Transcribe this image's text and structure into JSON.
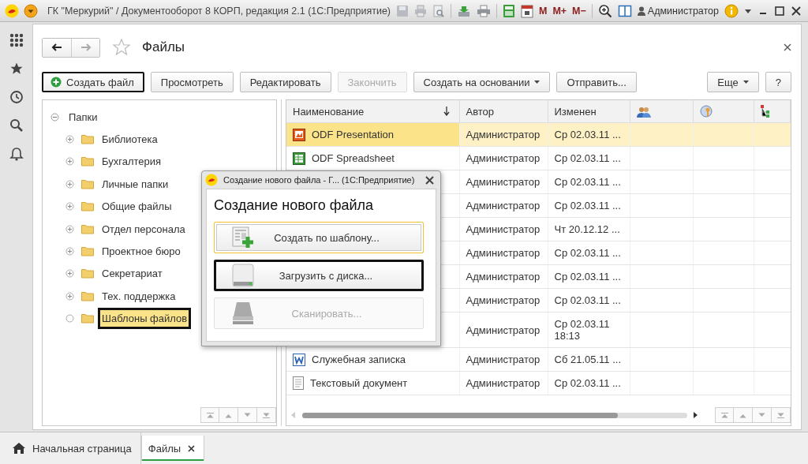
{
  "window": {
    "title": "ГК \"Меркурий\" / Документооборот 8 КОРП, редакция 2.1  (1С:Предприятие)",
    "memory_buttons": [
      "M",
      "M+",
      "M−"
    ],
    "user": "Администратор"
  },
  "page": {
    "title": "Файлы"
  },
  "toolbar": [
    {
      "label": "Создать файл",
      "kind": "create",
      "focused": true,
      "disabled": false
    },
    {
      "label": "Просмотреть",
      "kind": "plain",
      "focused": false,
      "disabled": false
    },
    {
      "label": "Редактировать",
      "kind": "plain",
      "focused": false,
      "disabled": false
    },
    {
      "label": "Закончить",
      "kind": "plain",
      "focused": false,
      "disabled": true
    },
    {
      "label": "Создать на основании",
      "kind": "menu",
      "focused": false,
      "disabled": false
    },
    {
      "label": "Отправить...",
      "kind": "plain",
      "focused": false,
      "disabled": false
    },
    {
      "label": "Еще",
      "kind": "more",
      "focused": false,
      "disabled": false
    },
    {
      "label": "?",
      "kind": "plain",
      "focused": false,
      "disabled": false
    }
  ],
  "tree": {
    "label": "Папки",
    "expanded": true,
    "children": [
      {
        "label": "Библиотека",
        "has_children": true,
        "selected": false
      },
      {
        "label": "Бухгалтерия",
        "has_children": true,
        "selected": false
      },
      {
        "label": "Личные папки",
        "has_children": true,
        "selected": false
      },
      {
        "label": "Общие файлы",
        "has_children": true,
        "selected": false
      },
      {
        "label": "Отдел персонала",
        "has_children": true,
        "selected": false
      },
      {
        "label": "Проектное бюро",
        "has_children": true,
        "selected": false
      },
      {
        "label": "Секретариат",
        "has_children": true,
        "selected": false
      },
      {
        "label": "Тех. поддержка",
        "has_children": true,
        "selected": false
      },
      {
        "label": "Шаблоны файлов",
        "has_children": false,
        "selected": true
      }
    ]
  },
  "table": {
    "columns": [
      {
        "label": "Наименование",
        "kind": "text",
        "sorted": true
      },
      {
        "label": "Автор",
        "kind": "text",
        "sorted": false
      },
      {
        "label": "Изменен",
        "kind": "text",
        "sorted": false
      },
      {
        "kind": "users"
      },
      {
        "kind": "key"
      },
      {
        "kind": "tree"
      }
    ],
    "rows": [
      {
        "kind": "presentation",
        "name": "ODF Presentation",
        "author": "Администратор",
        "changed": "Ср 02.03.11 ...",
        "selected": true
      },
      {
        "kind": "spreadsheet",
        "name": "ODF Spreadsheet",
        "author": "Администратор",
        "changed": "Ср 02.03.11 ...",
        "selected": false
      },
      {
        "author": "Администратор",
        "changed": "Ср 02.03.11 ...",
        "selected": false
      },
      {
        "author": "Администратор",
        "changed": "Ср 02.03.11 ...",
        "selected": false
      },
      {
        "author": "Администратор",
        "changed": "Чт 20.12.12 ...",
        "selected": false
      },
      {
        "author": "Администратор",
        "changed": "Ср 02.03.11 ...",
        "selected": false
      },
      {
        "author": "Администратор",
        "changed": "Ср 02.03.11 ...",
        "selected": false
      },
      {
        "author": "Администратор",
        "changed": "Ср 02.03.11 ...",
        "selected": false
      },
      {
        "author": "Администратор",
        "changed": "Ср 02.03.11\n18:13",
        "selected": false
      },
      {
        "kind": "word",
        "name": "Служебная записка",
        "author": "Администратор",
        "changed": "Сб 21.05.11 ...",
        "selected": false
      },
      {
        "kind": "text",
        "name": "Текстовый документ",
        "author": "Администратор",
        "changed": "Ср 02.03.11 ...",
        "selected": false
      }
    ]
  },
  "dialog": {
    "title": "Создание нового файла - Г...  (1С:Предприятие)",
    "heading": "Создание нового файла",
    "buttons": [
      {
        "label": "Создать по шаблону...",
        "kind": "template",
        "highlighted": true,
        "focused": false,
        "disabled": false
      },
      {
        "label": "Загрузить с диска...",
        "kind": "disk",
        "highlighted": false,
        "focused": true,
        "disabled": false
      },
      {
        "label": "Сканировать...",
        "kind": "scanner",
        "highlighted": false,
        "focused": false,
        "disabled": true
      }
    ]
  },
  "tabs": [
    {
      "label": "Начальная страница",
      "kind": "home",
      "selected": false
    },
    {
      "label": "Файлы",
      "kind": "closable",
      "selected": true
    }
  ]
}
